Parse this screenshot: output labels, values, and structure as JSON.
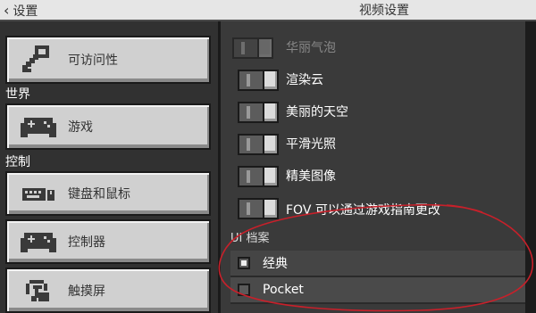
{
  "header": {
    "back_label": "设置",
    "title": "视频设置"
  },
  "sidebar": {
    "items": [
      {
        "label": "可访问性",
        "icon": "key-icon"
      },
      {
        "label": "游戏",
        "icon": "gamepad-icon"
      },
      {
        "label": "键盘和鼠标",
        "icon": "keyboard-icon"
      },
      {
        "label": "控制器",
        "icon": "gamepad-icon"
      },
      {
        "label": "触摸屏",
        "icon": "touch-hand-icon"
      }
    ],
    "sections": {
      "world": "世界",
      "control": "控制"
    }
  },
  "settings": {
    "toggles": [
      {
        "label": "华丽气泡",
        "enabled": false,
        "disabled": true
      },
      {
        "label": "渲染云",
        "enabled": true,
        "disabled": false
      },
      {
        "label": "美丽的天空",
        "enabled": true,
        "disabled": false
      },
      {
        "label": "平滑光照",
        "enabled": true,
        "disabled": false
      },
      {
        "label": "精美图像",
        "enabled": true,
        "disabled": false
      },
      {
        "label": "FOV 可以通过游戏指南更改",
        "enabled": true,
        "disabled": false
      }
    ],
    "ui_profile": {
      "label": "UI 档案",
      "options": [
        {
          "label": "经典",
          "selected": true
        },
        {
          "label": "Pocket",
          "selected": false
        }
      ]
    }
  },
  "colors": {
    "annotation": "#c8202a",
    "button_face": "#d0d0d0",
    "panel_dark": "#313131"
  }
}
